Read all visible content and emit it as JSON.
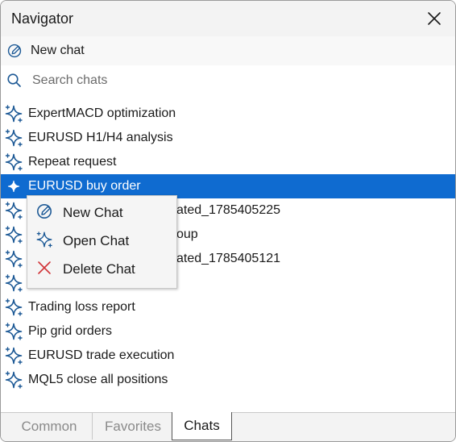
{
  "window": {
    "title": "Navigator"
  },
  "toolbar": {
    "new_chat_label": "New chat",
    "search_placeholder": "Search chats"
  },
  "chats": [
    {
      "label": "ExpertMACD optimization",
      "icon": "sparkle-icon"
    },
    {
      "label": "EURUSD H1/H4 analysis",
      "icon": "sparkle-icon"
    },
    {
      "label": "Repeat request",
      "icon": "sparkle-icon"
    },
    {
      "label": "EURUSD buy order",
      "icon": "sparkle-icon",
      "selected": true
    },
    {
      "label": "ated_1785405225",
      "icon": "sparkle-icon"
    },
    {
      "label": "oup",
      "icon": "sparkle-icon"
    },
    {
      "label": "ated_1785405121",
      "icon": "sparkle-icon"
    },
    {
      "label": "",
      "icon": "sparkle-icon"
    },
    {
      "label": "Trading loss report",
      "icon": "sparkle-icon"
    },
    {
      "label": "Pip grid orders",
      "icon": "sparkle-icon"
    },
    {
      "label": "EURUSD trade execution",
      "icon": "sparkle-icon"
    },
    {
      "label": "MQL5 close all positions",
      "icon": "sparkle-icon"
    }
  ],
  "context_menu": {
    "items": [
      {
        "label": "New Chat",
        "icon": "edit-icon"
      },
      {
        "label": "Open Chat",
        "icon": "sparkle-icon"
      },
      {
        "label": "Delete Chat",
        "icon": "close-icon"
      }
    ]
  },
  "tabs": [
    {
      "label": "Common"
    },
    {
      "label": "Favorites"
    },
    {
      "label": "Chats",
      "active": true
    }
  ],
  "colors": {
    "accent": "#0f6bd0",
    "icon_blue": "#1e5a96",
    "delete_red": "#d13438"
  }
}
